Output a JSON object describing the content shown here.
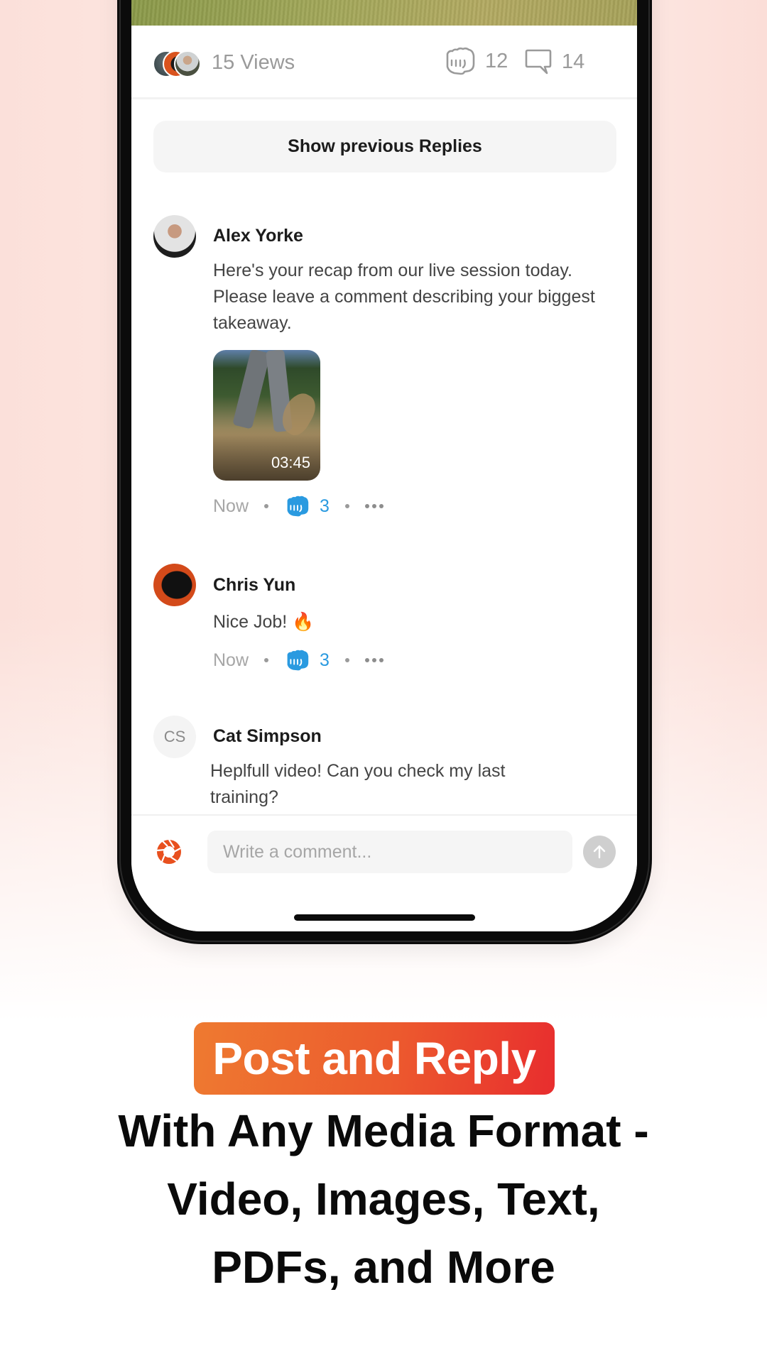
{
  "post": {
    "views_label": "15 Views",
    "reactions_count": "12",
    "comments_count": "14",
    "icons": {
      "reaction": "fist-bump-icon",
      "comments": "speech-bubble-icon"
    }
  },
  "show_previous_label": "Show previous Replies",
  "comments": [
    {
      "author": "Alex Yorke",
      "text": "Here's your recap from our live session today. Please leave a comment describing your biggest takeaway.",
      "attachment": {
        "type": "video",
        "duration": "03:45"
      },
      "time": "Now",
      "reactions": "3"
    },
    {
      "author": "Chris Yun",
      "text": "Nice Job! 🔥",
      "time": "Now",
      "reactions": "3"
    },
    {
      "author": "Cat Simpson",
      "initials": "CS",
      "text": "Heplfull video! Can you check my last training?"
    }
  ],
  "composer": {
    "placeholder": "Write a comment...",
    "value": ""
  },
  "marketing": {
    "pill": "Post and Reply",
    "headline_lines": [
      "With Any Media Format -",
      "Video, Images, Text,",
      "PDFs, and More"
    ]
  },
  "colors": {
    "accent_blue": "#2a9ae0",
    "brand_orange": "#e8501e",
    "pill_start": "#ee7a30",
    "pill_end": "#e82d2e"
  }
}
